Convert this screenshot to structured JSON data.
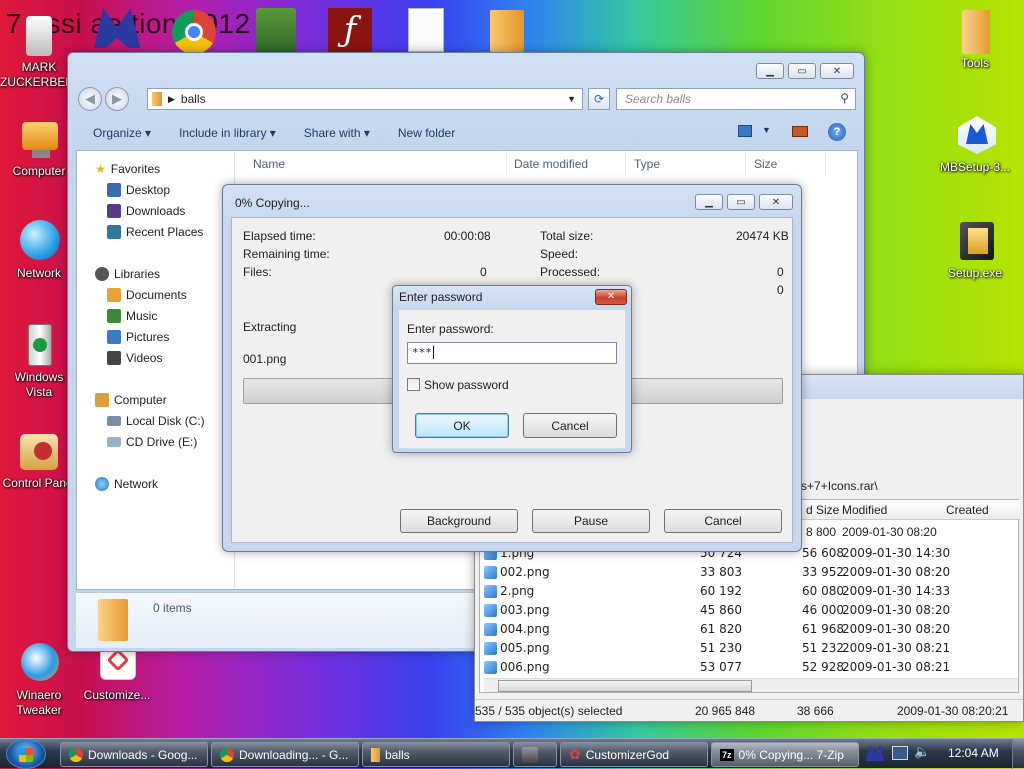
{
  "desktop": {
    "banner": "7 ossi ae tion 2012",
    "icons": [
      {
        "label": "MARK\nZUCKERBERG",
        "icon": "person-icon"
      },
      {
        "label": "Computer",
        "icon": "computer-icon"
      },
      {
        "label": "Network",
        "icon": "network-globe-icon"
      },
      {
        "label": "Windows\nVista",
        "icon": "recycle-bin-icon"
      },
      {
        "label": "Control Panel",
        "icon": "control-panel-icon"
      },
      {
        "label": "Winaero\nTweaker",
        "icon": "winaero-icon"
      },
      {
        "label": "Customize...",
        "icon": "customize-icon"
      },
      {
        "label": "Tools",
        "icon": "folder-icon"
      },
      {
        "label": "MBSetup-3...",
        "icon": "malwarebytes-icon"
      },
      {
        "label": "Setup.exe",
        "icon": "installer-icon"
      }
    ]
  },
  "explorer": {
    "address_crumb": "balls",
    "search_placeholder": "Search balls",
    "toolbar": [
      "Organize",
      "Include in library",
      "Share with",
      "New folder"
    ],
    "nav": {
      "favorites": "Favorites",
      "favorites_items": [
        "Desktop",
        "Downloads",
        "Recent Places"
      ],
      "libraries": "Libraries",
      "libraries_items": [
        "Documents",
        "Music",
        "Pictures",
        "Videos"
      ],
      "computer": "Computer",
      "computer_items": [
        "Local Disk (C:)",
        "CD Drive (E:)"
      ],
      "network": "Network"
    },
    "columns": [
      "Name",
      "Date modified",
      "Type",
      "Size"
    ],
    "status": "0 items"
  },
  "zip": {
    "path": "s+7+Icons.rar\\",
    "columns": [
      "d Size",
      "Modified",
      "Created"
    ],
    "rows": [
      {
        "name": "1.png",
        "size": "50 724",
        "packed": "56 608",
        "modified": "2009-01-30 14:30"
      },
      {
        "name": "002.png",
        "size": "33 803",
        "packed": "33 952",
        "modified": "2009-01-30 08:20"
      },
      {
        "name": "2.png",
        "size": "60 192",
        "packed": "60 080",
        "modified": "2009-01-30 14:33"
      },
      {
        "name": "003.png",
        "size": "45 860",
        "packed": "46 000",
        "modified": "2009-01-30 08:20"
      },
      {
        "name": "004.png",
        "size": "61 820",
        "packed": "61 968",
        "modified": "2009-01-30 08:20"
      },
      {
        "name": "005.png",
        "size": "51 230",
        "packed": "51 232",
        "modified": "2009-01-30 08:21"
      },
      {
        "name": "006.png",
        "size": "53 077",
        "packed": "52 928",
        "modified": "2009-01-30 08:21"
      }
    ],
    "first_row": {
      "packed": "8 800",
      "modified": "2009-01-30 08:20"
    },
    "status": {
      "selected": "535 / 535 object(s) selected",
      "total": "20 965 848",
      "packed": "38 666",
      "date": "2009-01-30 08:20:21"
    }
  },
  "copy": {
    "title": "0% Copying...",
    "elapsed_label": "Elapsed time:",
    "elapsed": "00:00:08",
    "remaining_label": "Remaining time:",
    "files_label": "Files:",
    "files": "0",
    "total_label": "Total size:",
    "total": "20474 KB",
    "speed_label": "Speed:",
    "processed_label": "Processed:",
    "processed": "0",
    "extra": "0",
    "action": "Extracting",
    "current_file": "001.png",
    "progress": 0,
    "buttons": [
      "Background",
      "Pause",
      "Cancel"
    ]
  },
  "password": {
    "title": "Enter password",
    "prompt": "Enter password:",
    "value": "***",
    "show_label": "Show password",
    "show_checked": false,
    "ok": "OK",
    "cancel": "Cancel"
  },
  "taskbar": {
    "items": [
      {
        "label": "Downloads - Goog...",
        "icon": "chrome-icon"
      },
      {
        "label": "Downloading... - G...",
        "icon": "chrome-icon"
      },
      {
        "label": "balls",
        "icon": "folder-icon"
      },
      {
        "label": "",
        "icon": "archive-icon"
      },
      {
        "label": "CustomizerGod",
        "icon": "gear-icon"
      },
      {
        "label": "0% Copying... 7-Zip",
        "icon": "7zip-icon"
      }
    ],
    "clock": "12:04 AM"
  },
  "colors": {
    "accent": "#1e395b",
    "close_red": "#c8422c"
  }
}
